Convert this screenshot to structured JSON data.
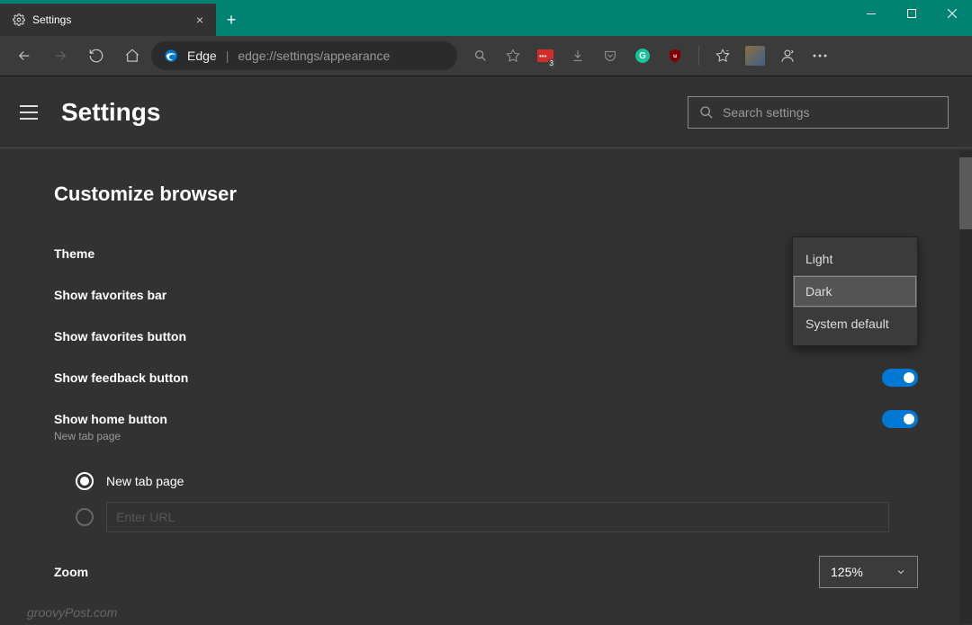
{
  "window": {
    "tab_title": "Settings",
    "minimize": "−",
    "maximize": "□",
    "close": "×",
    "new_tab": "+"
  },
  "toolbar": {
    "profile_label": "Edge",
    "url": "edge://settings/appearance"
  },
  "header": {
    "title": "Settings",
    "search_placeholder": "Search settings"
  },
  "section": {
    "title": "Customize browser",
    "theme": {
      "label": "Theme",
      "value": "Dark",
      "options": [
        "Light",
        "Dark",
        "System default"
      ],
      "hover_index": 1
    },
    "favbar": {
      "label": "Show favorites bar"
    },
    "favbtn": {
      "label": "Show favorites button"
    },
    "feedback": {
      "label": "Show feedback button",
      "on": true
    },
    "home": {
      "label": "Show home button",
      "sub": "New tab page",
      "on": true
    },
    "home_opts": {
      "newtab": "New tab page",
      "url_placeholder": "Enter URL"
    },
    "zoom": {
      "label": "Zoom",
      "value": "125%"
    }
  },
  "watermark": "groovyPost.com"
}
